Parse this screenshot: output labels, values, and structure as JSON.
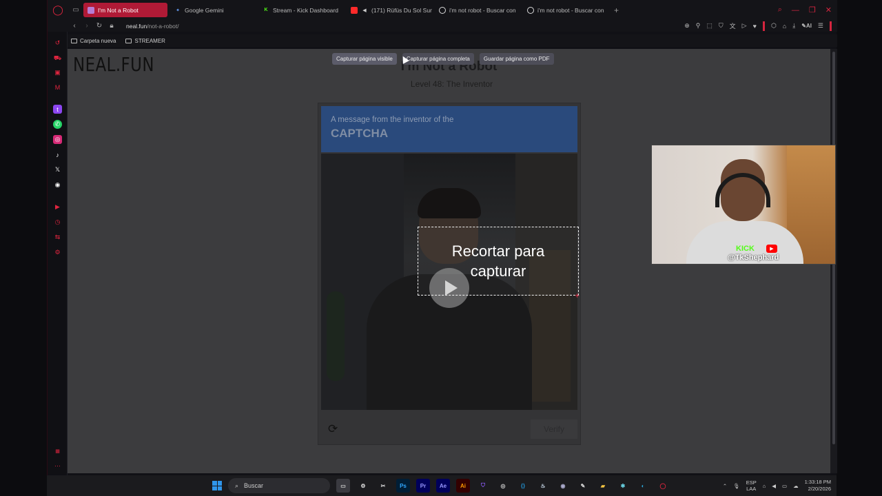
{
  "browser": {
    "tabs": [
      {
        "label": "I'm Not a Robot",
        "active": true,
        "fav_color": "#b87dd4"
      },
      {
        "label": "Google Gemini",
        "active": false,
        "fav_color": "#6aa3ff"
      },
      {
        "label": "Stream - Kick Dashboard",
        "active": false,
        "fav_color": "#53fc18"
      },
      {
        "label": "(171) Rüfüs Du Sol Sun",
        "active": false,
        "fav_color": "#ff2a2a"
      },
      {
        "label": "i'm not robot - Buscar con",
        "active": false,
        "fav_color": "#dddddd"
      },
      {
        "label": "i'm not robot - Buscar con",
        "active": false,
        "fav_color": "#dddddd"
      }
    ],
    "new_tab_glyph": "+",
    "url_domain": "neal.fun",
    "url_path": "/not-a-robot/",
    "toolbar_ai_label": "AI",
    "bookmarks": [
      {
        "label": "Carpeta nueva"
      },
      {
        "label": "STREAMER"
      }
    ]
  },
  "page": {
    "logo": "NEAL.FUN",
    "title": "I'm Not a Robot",
    "subtitle": "Level 48: The Inventor",
    "captcha": {
      "message": "A message from the inventor of the",
      "heading": "CAPTCHA",
      "verify_label": "Verify"
    }
  },
  "capture_menu": {
    "buttons": [
      "Capturar página visible",
      "Capturar página completa",
      "Guardar página como PDF"
    ]
  },
  "crop_overlay": {
    "line1": "Recortar para",
    "line2": "capturar"
  },
  "webcam": {
    "kick_label": "KICK",
    "handle": "@TkShephard"
  },
  "taskbar": {
    "search_label": "Buscar",
    "lang_top": "ESP",
    "lang_bottom": "LAA",
    "time": "1:33:18 PM",
    "date": "2/20/2026"
  },
  "colors": {
    "accent": "#e0253f",
    "active_tab": "#b01a36",
    "captcha_header": "#2a4a7c"
  }
}
